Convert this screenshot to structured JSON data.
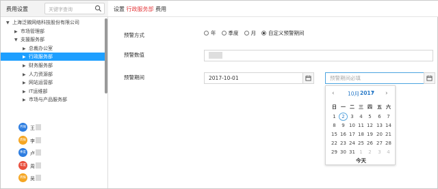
{
  "sidebar": {
    "title": "费用设置",
    "search_placeholder": "关键字查询",
    "tree": [
      {
        "label": "上海泛微网络科技股份有限公司",
        "level": 0,
        "arrow": "▼",
        "selected": false
      },
      {
        "label": "市场管理部",
        "level": 1,
        "arrow": "▶",
        "selected": false
      },
      {
        "label": "支援服务部",
        "level": 1,
        "arrow": "▼",
        "selected": false
      },
      {
        "label": "总裁办公室",
        "level": 2,
        "arrow": "▶",
        "selected": false
      },
      {
        "label": "行政服务部",
        "level": 2,
        "arrow": "▶",
        "selected": true
      },
      {
        "label": "财务服务部",
        "level": 2,
        "arrow": "▶",
        "selected": false
      },
      {
        "label": "人力资源部",
        "level": 2,
        "arrow": "▶",
        "selected": false
      },
      {
        "label": "网站运营部",
        "level": 2,
        "arrow": "▶",
        "selected": false
      },
      {
        "label": "IT运维部",
        "level": 2,
        "arrow": "▶",
        "selected": false
      },
      {
        "label": "市场与产品服务部",
        "level": 2,
        "arrow": "▶",
        "selected": false
      }
    ],
    "people": [
      {
        "badge": "月報",
        "color": "#2d7de0",
        "name": "王"
      },
      {
        "badge": "周报",
        "color": "#f5a623",
        "name": "李"
      },
      {
        "badge": "季度",
        "color": "#2d7de0",
        "name": "卢"
      },
      {
        "badge": "年度",
        "color": "#e94e3c",
        "name": "周"
      },
      {
        "badge": "周报",
        "color": "#f5a623",
        "name": "吴"
      }
    ]
  },
  "topbar": {
    "prefix": "设置",
    "dept": "行政服务部",
    "suffix": "费用"
  },
  "form": {
    "method_label": "预警方式",
    "method_options": [
      {
        "label": "年",
        "checked": false
      },
      {
        "label": "季度",
        "checked": false
      },
      {
        "label": "月",
        "checked": false
      },
      {
        "label": "自定义预警期间",
        "checked": true
      }
    ],
    "value_label": "预警数值",
    "period_label": "预警期间",
    "start_date": "2017-10-01",
    "end_placeholder": "预警期间必填"
  },
  "calendar": {
    "prev": "‹",
    "next": "›",
    "month": "10月",
    "year": "2017",
    "caret": "▼",
    "weekdays": [
      "日",
      "一",
      "二",
      "三",
      "四",
      "五",
      "六"
    ],
    "rows": [
      [
        "1",
        "2",
        "3",
        "4",
        "5",
        "6",
        "7"
      ],
      [
        "8",
        "9",
        "10",
        "11",
        "12",
        "13",
        "14"
      ],
      [
        "15",
        "16",
        "17",
        "18",
        "19",
        "20",
        "21"
      ],
      [
        "22",
        "23",
        "24",
        "25",
        "26",
        "27",
        "28"
      ],
      [
        "29",
        "30",
        "31",
        "1",
        "2",
        "3",
        "4"
      ]
    ],
    "muted_last_row_from": 3,
    "today_index": [
      0,
      1
    ],
    "today_label": "今天"
  },
  "colors": {
    "accent": "#1e9fff",
    "highlight": "#e4393c",
    "link": "#2b7bc8"
  }
}
